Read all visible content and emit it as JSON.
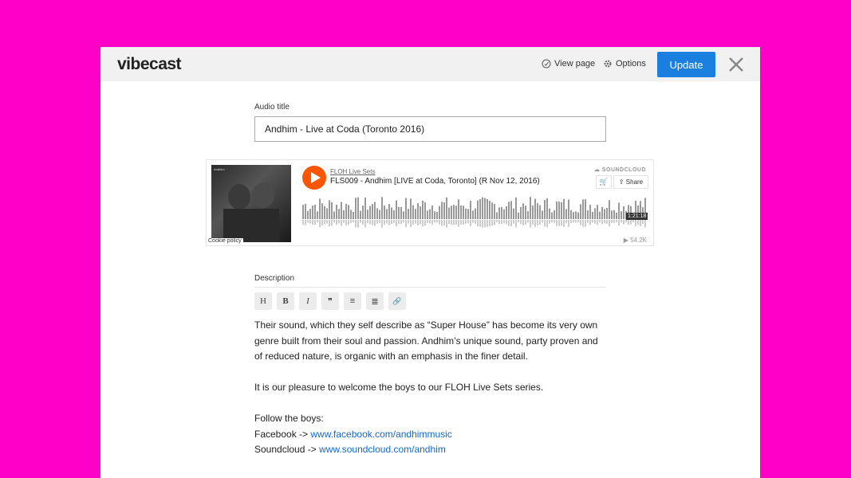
{
  "header": {
    "logo": "vibecast",
    "view_page": "View page",
    "options": "Options",
    "update": "Update"
  },
  "form": {
    "audio_title_label": "Audio title",
    "audio_title_value": "Andhim - Live at Coda (Toronto 2016)",
    "description_label": "Description"
  },
  "embed": {
    "uploader": "FLOH Live Sets",
    "track_title": "FLS009 - Andhim [LIVE at Coda, Toronto] (R Nov 12, 2016)",
    "brand": "SOUNDCLOUD",
    "share": "Share",
    "duration": "1:21:18",
    "plays": "54.2K",
    "cookie_policy": "Cookie policy",
    "art_text": "Andhim",
    "accent": "#ff5500"
  },
  "toolbar": {
    "heading": "H",
    "bold": "B",
    "italic": "I",
    "quote": "❞",
    "ordered_list": "≡",
    "unordered_list": "≣",
    "link": "🔗"
  },
  "description": {
    "p1": "Their sound, which they self describe as “Super House” has become its very own genre built from their soul and passion. Andhim’s unique sound, party proven and of reduced nature, is organic with an emphasis in the finer detail.",
    "p2": "It is our pleasure to welcome the boys to our FLOH Live Sets series.",
    "follow": "Follow the boys:",
    "fb_prefix": "Facebook -> ",
    "fb_link": "www.facebook.com/andhimmusic",
    "sc_prefix": "Soundcloud -> ",
    "sc_link": "www.soundcloud.com/andhim"
  },
  "colors": {
    "background": "#ff00c8",
    "primary": "#1b7fe0",
    "link": "#1668c7"
  }
}
